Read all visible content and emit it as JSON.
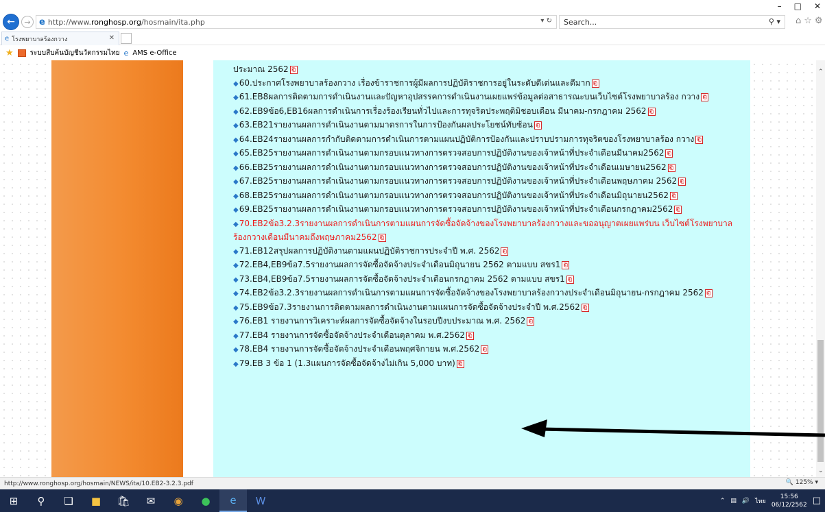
{
  "browser": {
    "url_prefix": "http://www.",
    "url_domain": "ronghosp.org",
    "url_path": "/hosmain/ita.php",
    "search_placeholder": "Search...",
    "tab_title": "โรงพยาบาลร้องกวาง",
    "favorites": [
      "ระบบสืบค้นบัญชีนวัตกรรมไทย",
      "AMS e-Office"
    ],
    "status_url": "http://www.ronghosp.org/hosmain/NEWS/ita/10.EB2-3.2.3.pdf",
    "zoom": "125%"
  },
  "document_items": [
    {
      "text": "ประมาณ 2562",
      "red": false,
      "bullet": false
    },
    {
      "text": "60.ประกาศโรงพยาบาลร้องกวาง เรื่องข้าราชการผู้มีผลการปฏิบัติราชการอยู่ในระดับดีเด่นและดีมาก",
      "red": false,
      "bullet": true
    },
    {
      "text": "61.EB8ผลการติดตามการดำเนินงานและปัญหาอุปสรรคการดำเนินงานเผยแพร่ข้อมูลต่อสาธารณะบนเว็บไซต์โรงพยาบาลร้อง กวาง",
      "red": false,
      "bullet": true
    },
    {
      "text": "62.EB9ข้อ6,EB16ผลการดำเนินการเรื่องร้องเรียนทั่วไปและการทุจริตประพฤติมิชอบเดือน มีนาคม-กรกฎาคม 2562",
      "red": false,
      "bullet": true
    },
    {
      "text": "63.EB21รายงานผลการดำเนินงานตามมาตรการในการป้องกันผลประโยชน์ทับซ้อน",
      "red": false,
      "bullet": true
    },
    {
      "text": "64.EB24รายงานผลการกำกับติดตามการดำเนินการตามแผนปฏิบัติการป้องกันและปราบปรามการทุจริตของโรงพยาบาลร้อง กวาง",
      "red": false,
      "bullet": true
    },
    {
      "text": "65.EB25รายงานผลการดำเนินงานตามกรอบแนวทางการตรวจสอบการปฏิบัติงานของเจ้าหน้าที่ประจำเดือนมีนาคม2562",
      "red": false,
      "bullet": true
    },
    {
      "text": "66.EB25รายงานผลการดำเนินงานตามกรอบแนวทางการตรวจสอบการปฏิบัติงานของเจ้าหน้าที่ประจำเดือนเมษายน2562",
      "red": false,
      "bullet": true
    },
    {
      "text": "67.EB25รายงานผลการดำเนินงานตามกรอบแนวทางการตรวจสอบการปฏิบัติงานของเจ้าหน้าที่ประจำเดือนพฤษภาคม 2562",
      "red": false,
      "bullet": true
    },
    {
      "text": "68.EB25รายงานผลการดำเนินงานตามกรอบแนวทางการตรวจสอบการปฏิบัติงานของเจ้าหน้าที่ประจำเดือนมิถุนายน2562",
      "red": false,
      "bullet": true
    },
    {
      "text": "69.EB25รายงานผลการดำเนินงานตามกรอบแนวทางการตรวจสอบการปฏิบัติงานของเจ้าหน้าที่ประจำเดือนกรกฎาคม2562",
      "red": false,
      "bullet": true
    },
    {
      "text": "70.EB2ข้อ3.2.3รายงานผลการดำเนินการตามแผนการจัดซื้อจัดจ้างของโรงพยาบาลร้องกวางและขออนุญาตเผยแพร่บน เว็บไซต์โรงพยาบาลร้องกวางเดือนมีนาคมถึงพฤษภาคม2562",
      "red": true,
      "bullet": true
    },
    {
      "text": "71.EB12สรุปผลการปฏิบัติงานตามแผนปฏิบัติราชการประจำปี พ.ศ. 2562",
      "red": false,
      "bullet": true
    },
    {
      "text": "72.EB4,EB9ข้อ7.5รายงานผลการจัดซื้อจัดจ้างประจำเดือนมิถุนายน 2562 ตามแบบ สขร1",
      "red": false,
      "bullet": true
    },
    {
      "text": "73.EB4,EB9ข้อ7.5รายงานผลการจัดซื้อจัดจ้างประจำเดือนกรกฎาคม 2562 ตามแบบ สขร1",
      "red": false,
      "bullet": true
    },
    {
      "text": "74.EB2ข้อ3.2.3รายงานผลการดำเนินการตามแผนการจัดซื้อจัดจ้างของโรงพยาบาลร้องกวางประจำเดือนมิถุนายน-กรกฎาคม 2562",
      "red": false,
      "bullet": true
    },
    {
      "text": "75.EB9ข้อ7.3รายงานการติดตามผลการดำเนินงานตามแผนการจัดซื้อจัดจ้างประจำปี พ.ศ.2562",
      "red": false,
      "bullet": true
    },
    {
      "text": "76.EB1 รายงานการวิเคราะห์ผลการจัดซื้อจัดจ้างในรอบปีงบประมาณ พ.ศ. 2562",
      "red": false,
      "bullet": true
    },
    {
      "text": "77.EB4 รายงานการจัดซื้อจัดจ้างประจำเดือนตุลาคม พ.ศ.2562",
      "red": false,
      "bullet": true
    },
    {
      "text": "78.EB4 รายงานการจัดซื้อจัดจ้างประจำเดือนพฤศจิกายน พ.ศ.2562",
      "red": false,
      "bullet": true
    },
    {
      "text": "79.EB 3 ข้อ 1 (1.3แผนการจัดซื้อจัดจ้างไม่เกิน 5,000 บาท)",
      "red": false,
      "bullet": true
    }
  ],
  "taskbar": {
    "lang": "ไทย",
    "time": "15:56",
    "date": "06/12/2562"
  },
  "colors": {
    "orange": "#f38b30",
    "cyan": "#ccfdfd",
    "red_link": "#ee1c1c",
    "taskbar": "#1b2a4a"
  }
}
